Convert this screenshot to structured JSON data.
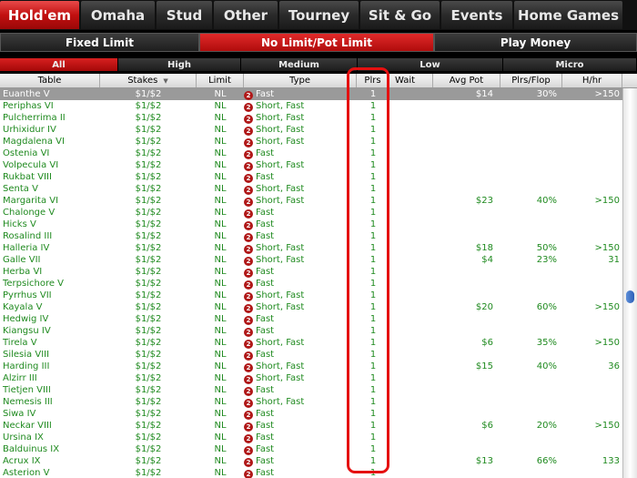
{
  "game_tabs": [
    {
      "label": "Hold'em",
      "active": true,
      "w": 89
    },
    {
      "label": "Omaha",
      "active": false,
      "w": 83
    },
    {
      "label": "Stud",
      "active": false,
      "w": 63
    },
    {
      "label": "Other",
      "active": false,
      "w": 72
    },
    {
      "label": "Tourney",
      "active": false,
      "w": 89
    },
    {
      "label": "Sit & Go",
      "active": false,
      "w": 89
    },
    {
      "label": "Events",
      "active": false,
      "w": 80
    },
    {
      "label": "Home Games",
      "active": false,
      "w": 121
    }
  ],
  "limit_tabs": [
    {
      "label": "Fixed Limit",
      "active": false
    },
    {
      "label": "No Limit/Pot Limit",
      "active": true
    },
    {
      "label": "Play Money",
      "active": false
    }
  ],
  "stakes_tabs": [
    {
      "label": "All",
      "active": true
    },
    {
      "label": "High",
      "active": false
    },
    {
      "label": "Medium",
      "active": false
    },
    {
      "label": "Low",
      "active": false
    },
    {
      "label": "Micro",
      "active": false
    }
  ],
  "columns": {
    "table": "Table",
    "stakes": "Stakes",
    "limit": "Limit",
    "type": "Type",
    "plrs": "Plrs",
    "wait": "Wait",
    "avg_pot": "Avg Pot",
    "plrs_flop": "Plrs/Flop",
    "hhr": "H/hr"
  },
  "type_icon_glyph": "2",
  "rows": [
    {
      "name": "Euanthe V",
      "stakes": "$1/$2",
      "limit": "NL",
      "type": "Fast",
      "plrs": "1",
      "avg": "$14",
      "flop": "30%",
      "hhr": ">150",
      "selected": true
    },
    {
      "name": "Periphas VI",
      "stakes": "$1/$2",
      "limit": "NL",
      "type": "Short, Fast",
      "plrs": "1",
      "avg": "",
      "flop": "",
      "hhr": ""
    },
    {
      "name": "Pulcherrima II",
      "stakes": "$1/$2",
      "limit": "NL",
      "type": "Short, Fast",
      "plrs": "1",
      "avg": "",
      "flop": "",
      "hhr": ""
    },
    {
      "name": "Urhixidur IV",
      "stakes": "$1/$2",
      "limit": "NL",
      "type": "Short, Fast",
      "plrs": "1",
      "avg": "",
      "flop": "",
      "hhr": ""
    },
    {
      "name": "Magdalena VI",
      "stakes": "$1/$2",
      "limit": "NL",
      "type": "Short, Fast",
      "plrs": "1",
      "avg": "",
      "flop": "",
      "hhr": ""
    },
    {
      "name": "Ostenia VI",
      "stakes": "$1/$2",
      "limit": "NL",
      "type": "Fast",
      "plrs": "1",
      "avg": "",
      "flop": "",
      "hhr": ""
    },
    {
      "name": "Volpecula VI",
      "stakes": "$1/$2",
      "limit": "NL",
      "type": "Short, Fast",
      "plrs": "1",
      "avg": "",
      "flop": "",
      "hhr": ""
    },
    {
      "name": "Rukbat VIII",
      "stakes": "$1/$2",
      "limit": "NL",
      "type": "Fast",
      "plrs": "1",
      "avg": "",
      "flop": "",
      "hhr": ""
    },
    {
      "name": "Senta V",
      "stakes": "$1/$2",
      "limit": "NL",
      "type": "Short, Fast",
      "plrs": "1",
      "avg": "",
      "flop": "",
      "hhr": ""
    },
    {
      "name": "Margarita VI",
      "stakes": "$1/$2",
      "limit": "NL",
      "type": "Short, Fast",
      "plrs": "1",
      "avg": "$23",
      "flop": "40%",
      "hhr": ">150"
    },
    {
      "name": "Chalonge V",
      "stakes": "$1/$2",
      "limit": "NL",
      "type": "Fast",
      "plrs": "1",
      "avg": "",
      "flop": "",
      "hhr": ""
    },
    {
      "name": "Hicks V",
      "stakes": "$1/$2",
      "limit": "NL",
      "type": "Fast",
      "plrs": "1",
      "avg": "",
      "flop": "",
      "hhr": ""
    },
    {
      "name": "Rosalind III",
      "stakes": "$1/$2",
      "limit": "NL",
      "type": "Fast",
      "plrs": "1",
      "avg": "",
      "flop": "",
      "hhr": ""
    },
    {
      "name": "Halleria IV",
      "stakes": "$1/$2",
      "limit": "NL",
      "type": "Short, Fast",
      "plrs": "1",
      "avg": "$18",
      "flop": "50%",
      "hhr": ">150"
    },
    {
      "name": "Galle VII",
      "stakes": "$1/$2",
      "limit": "NL",
      "type": "Short, Fast",
      "plrs": "1",
      "avg": "$4",
      "flop": "23%",
      "hhr": "31"
    },
    {
      "name": "Herba VI",
      "stakes": "$1/$2",
      "limit": "NL",
      "type": "Fast",
      "plrs": "1",
      "avg": "",
      "flop": "",
      "hhr": ""
    },
    {
      "name": "Terpsichore V",
      "stakes": "$1/$2",
      "limit": "NL",
      "type": "Fast",
      "plrs": "1",
      "avg": "",
      "flop": "",
      "hhr": ""
    },
    {
      "name": "Pyrrhus VII",
      "stakes": "$1/$2",
      "limit": "NL",
      "type": "Short, Fast",
      "plrs": "1",
      "avg": "",
      "flop": "",
      "hhr": ""
    },
    {
      "name": "Kayala V",
      "stakes": "$1/$2",
      "limit": "NL",
      "type": "Short, Fast",
      "plrs": "1",
      "avg": "$20",
      "flop": "60%",
      "hhr": ">150"
    },
    {
      "name": "Hedwig IV",
      "stakes": "$1/$2",
      "limit": "NL",
      "type": "Fast",
      "plrs": "1",
      "avg": "",
      "flop": "",
      "hhr": ""
    },
    {
      "name": "Kiangsu IV",
      "stakes": "$1/$2",
      "limit": "NL",
      "type": "Fast",
      "plrs": "1",
      "avg": "",
      "flop": "",
      "hhr": ""
    },
    {
      "name": "Tirela V",
      "stakes": "$1/$2",
      "limit": "NL",
      "type": "Short, Fast",
      "plrs": "1",
      "avg": "$6",
      "flop": "35%",
      "hhr": ">150"
    },
    {
      "name": "Silesia VIII",
      "stakes": "$1/$2",
      "limit": "NL",
      "type": "Fast",
      "plrs": "1",
      "avg": "",
      "flop": "",
      "hhr": ""
    },
    {
      "name": "Harding III",
      "stakes": "$1/$2",
      "limit": "NL",
      "type": "Short, Fast",
      "plrs": "1",
      "avg": "$15",
      "flop": "40%",
      "hhr": "36"
    },
    {
      "name": "Alzirr III",
      "stakes": "$1/$2",
      "limit": "NL",
      "type": "Short, Fast",
      "plrs": "1",
      "avg": "",
      "flop": "",
      "hhr": ""
    },
    {
      "name": "Tietjen VIII",
      "stakes": "$1/$2",
      "limit": "NL",
      "type": "Fast",
      "plrs": "1",
      "avg": "",
      "flop": "",
      "hhr": ""
    },
    {
      "name": "Nemesis III",
      "stakes": "$1/$2",
      "limit": "NL",
      "type": "Short, Fast",
      "plrs": "1",
      "avg": "",
      "flop": "",
      "hhr": ""
    },
    {
      "name": "Siwa IV",
      "stakes": "$1/$2",
      "limit": "NL",
      "type": "Fast",
      "plrs": "1",
      "avg": "",
      "flop": "",
      "hhr": ""
    },
    {
      "name": "Neckar VIII",
      "stakes": "$1/$2",
      "limit": "NL",
      "type": "Fast",
      "plrs": "1",
      "avg": "$6",
      "flop": "20%",
      "hhr": ">150"
    },
    {
      "name": "Ursina IX",
      "stakes": "$1/$2",
      "limit": "NL",
      "type": "Fast",
      "plrs": "1",
      "avg": "",
      "flop": "",
      "hhr": ""
    },
    {
      "name": "Balduinus IX",
      "stakes": "$1/$2",
      "limit": "NL",
      "type": "Fast",
      "plrs": "1",
      "avg": "",
      "flop": "",
      "hhr": ""
    },
    {
      "name": "Acrux IX",
      "stakes": "$1/$2",
      "limit": "NL",
      "type": "Fast",
      "plrs": "1",
      "avg": "$13",
      "flop": "66%",
      "hhr": "133"
    },
    {
      "name": "Asterion V",
      "stakes": "$1/$2",
      "limit": "NL",
      "type": "Fast",
      "plrs": "1",
      "avg": "",
      "flop": "",
      "hhr": ""
    }
  ]
}
